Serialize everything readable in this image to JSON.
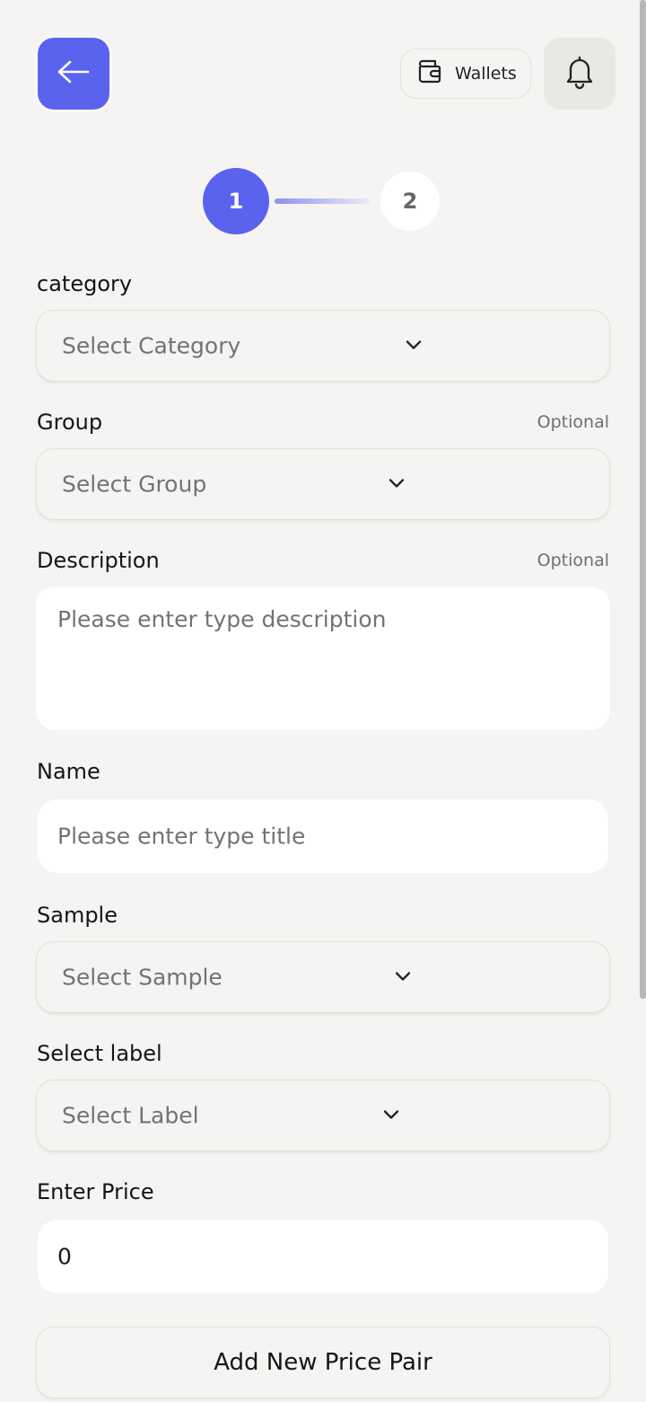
{
  "header": {
    "back_icon": "arrow-left-icon",
    "wallets_label": "Wallets",
    "wallet_icon": "wallet-icon",
    "bell_icon": "bell-icon"
  },
  "stepper": {
    "step1": "1",
    "step2": "2",
    "active_step": 1
  },
  "form": {
    "category": {
      "label": "category",
      "placeholder": "Select Category"
    },
    "group": {
      "label": "Group",
      "optional": "Optional",
      "placeholder": "Select Group"
    },
    "description": {
      "label": "Description",
      "optional": "Optional",
      "placeholder": "Please enter type description"
    },
    "name": {
      "label": "Name",
      "placeholder": "Please enter type title"
    },
    "sample": {
      "label": "Sample",
      "placeholder": "Select Sample"
    },
    "select_label": {
      "label": "Select label",
      "placeholder": "Select Label"
    },
    "price": {
      "label": "Enter Price",
      "value": "0"
    },
    "add_button": "Add New Price Pair"
  },
  "colors": {
    "accent": "#5a63ee",
    "background": "#f5f4f2"
  }
}
